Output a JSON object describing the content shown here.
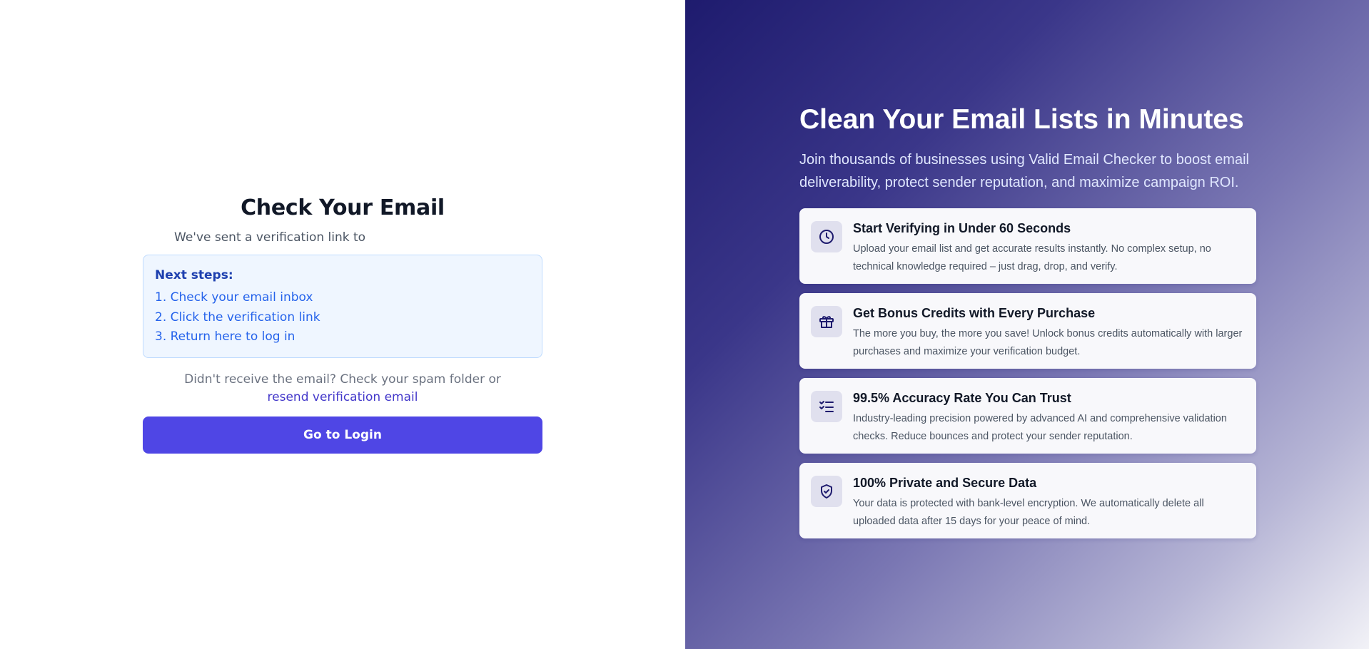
{
  "left": {
    "title": "Check Your Email",
    "sent_text": "We've sent a verification link to",
    "steps": {
      "title": "Next steps:",
      "items": [
        "1. Check your email inbox",
        "2. Click the verification link",
        "3. Return here to log in"
      ]
    },
    "resend_prompt": "Didn't receive the email? Check your spam folder or",
    "resend_link": "resend verification email",
    "login_button": "Go to Login"
  },
  "right": {
    "title": "Clean Your Email Lists in Minutes",
    "subtitle": "Join thousands of businesses using Valid Email Checker to boost email deliverability, protect sender reputation, and maximize campaign ROI.",
    "features": [
      {
        "icon": "clock-icon",
        "title": "Start Verifying in Under 60 Seconds",
        "description": "Upload your email list and get accurate results instantly. No complex setup, no technical knowledge required – just drag, drop, and verify."
      },
      {
        "icon": "gift-icon",
        "title": "Get Bonus Credits with Every Purchase",
        "description": "The more you buy, the more you save! Unlock bonus credits automatically with larger purchases and maximize your verification budget."
      },
      {
        "icon": "checklist-icon",
        "title": "99.5% Accuracy Rate You Can Trust",
        "description": "Industry-leading precision powered by advanced AI and comprehensive validation checks. Reduce bounces and protect your sender reputation."
      },
      {
        "icon": "shield-check-icon",
        "title": "100% Private and Secure Data",
        "description": "Your data is protected with bank-level encryption. We automatically delete all uploaded data after 15 days for your peace of mind."
      }
    ]
  },
  "colors": {
    "primary_button": "#4f46e5",
    "link": "#4338ca",
    "steps_bg": "#eff6ff",
    "gradient_dark": "#1e1b6e"
  }
}
